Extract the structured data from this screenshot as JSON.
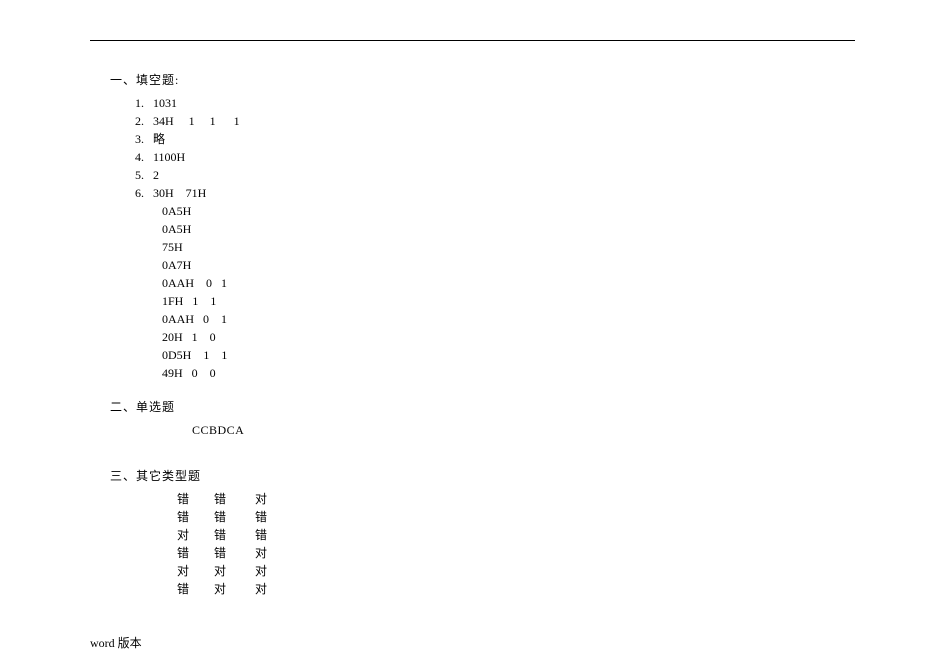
{
  "section1": {
    "title": "一、填空题:",
    "items": [
      {
        "num": "1.",
        "text": "1031"
      },
      {
        "num": "2.",
        "text": "34H     1     1      1"
      },
      {
        "num": "3.",
        "text": "略"
      },
      {
        "num": "4.",
        "text": "1100H"
      },
      {
        "num": "5.",
        "text": "2"
      },
      {
        "num": "6.",
        "text": "30H    71H"
      }
    ],
    "sublines": [
      "0A5H",
      "0A5H",
      "75H",
      "0A7H",
      "0AAH    0   1",
      "1FH   1    1",
      "0AAH   0    1",
      "20H   1    0",
      "0D5H    1    1",
      "49H   0    0"
    ]
  },
  "section2": {
    "title": "二、单选题",
    "answers": "CCBDCA"
  },
  "section3": {
    "title": "三、其它类型题",
    "rows": [
      "错      错       对",
      "错      错       错",
      "对      错       错",
      "错      错       对",
      "对      对       对",
      "错      对       对"
    ]
  },
  "footer": "word 版本"
}
